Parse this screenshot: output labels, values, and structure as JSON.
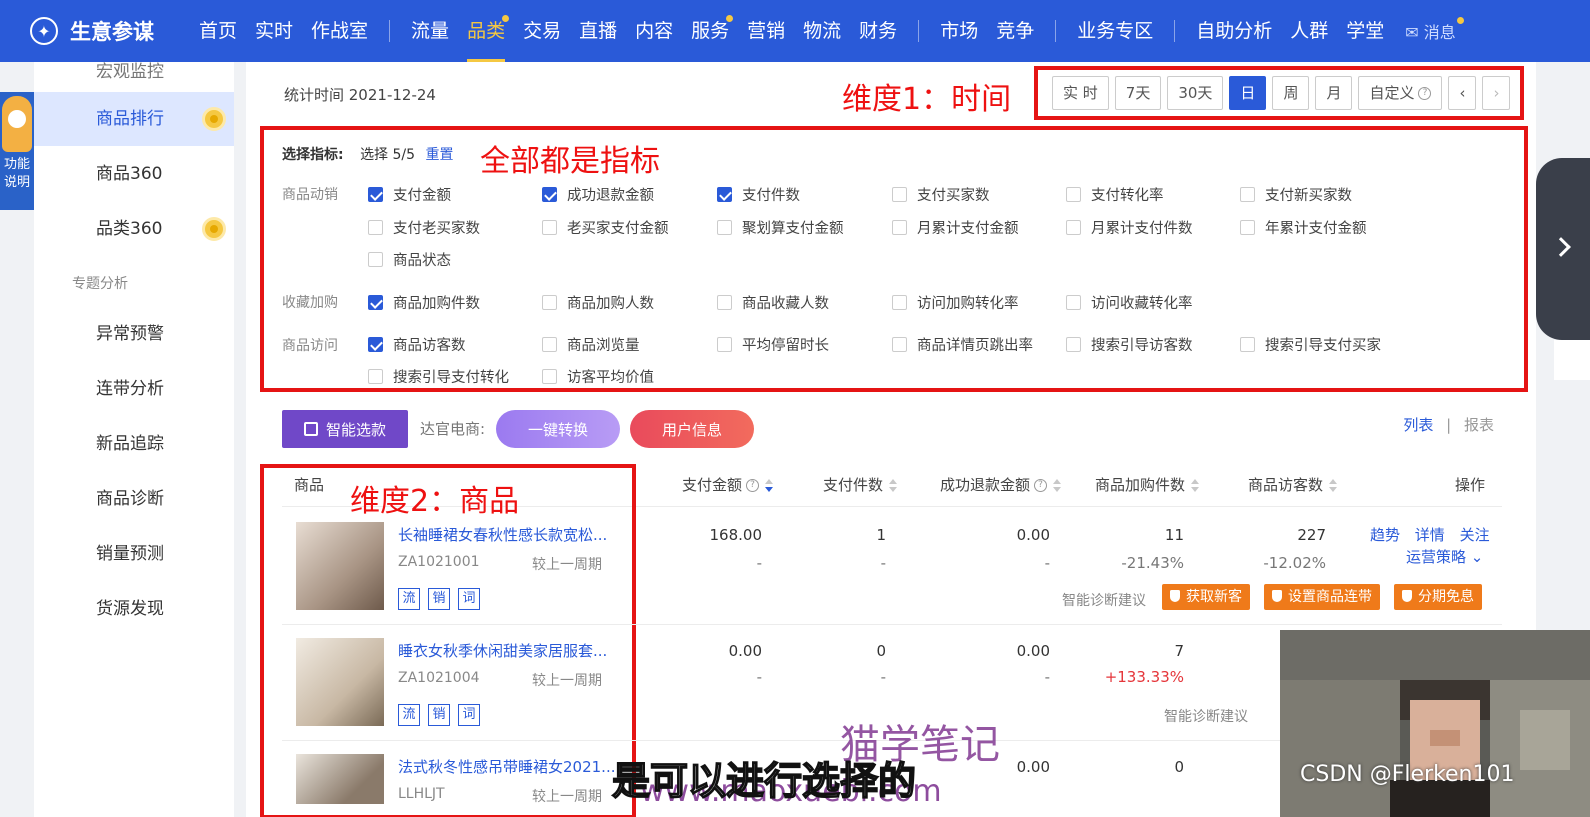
{
  "topnav": {
    "logo_text": "生意参谋",
    "items": [
      "首页",
      "实时",
      "作战室",
      "流量",
      "品类",
      "交易",
      "直播",
      "内容",
      "服务",
      "营销",
      "物流",
      "财务",
      "市场",
      "竞争",
      "业务专区",
      "自助分析",
      "人群",
      "学堂"
    ],
    "active": "品类",
    "message": "消息"
  },
  "helper": {
    "label": "功能说明"
  },
  "sidebar": {
    "top_partial": "宏观监控",
    "items_a": [
      "商品排行",
      "商品360",
      "品类360"
    ],
    "section": "专题分析",
    "items_b": [
      "异常预警",
      "连带分析",
      "新品追踪",
      "商品诊断",
      "销量预测",
      "货源发现"
    ]
  },
  "main": {
    "stat_time": "统计时间 2021-12-24",
    "time_buttons": [
      "实 时",
      "7天",
      "30天",
      "日",
      "周",
      "月",
      "自定义"
    ],
    "time_active": "日",
    "annotations": {
      "time": "维度1：时间",
      "metrics": "全部都是指标",
      "product": "维度2：商品"
    },
    "metrics": {
      "select_label": "选择指标:",
      "count": "选择 5/5",
      "reset": "重置",
      "groups": [
        {
          "label": "商品动销",
          "items": [
            "支付金额",
            "成功退款金额",
            "支付件数",
            "支付买家数",
            "支付转化率",
            "支付新买家数",
            "支付老买家数",
            "老买家支付金额",
            "聚划算支付金额",
            "月累计支付金额",
            "月累计支付件数",
            "年累计支付金额",
            "商品状态"
          ],
          "checked": [
            0,
            1,
            2
          ]
        },
        {
          "label": "收藏加购",
          "items": [
            "商品加购件数",
            "商品加购人数",
            "商品收藏人数",
            "访问加购转化率",
            "访问收藏转化率"
          ],
          "checked": [
            0
          ]
        },
        {
          "label": "商品访问",
          "items": [
            "商品访客数",
            "商品浏览量",
            "平均停留时长",
            "商品详情页跳出率",
            "搜索引导访客数",
            "搜索引导支付买家",
            "搜索引导支付转化",
            "访客平均价值"
          ],
          "checked": [
            0
          ]
        }
      ]
    },
    "toolbar": {
      "smart": "智能选款",
      "daguan": "达官电商:",
      "convert": "一键转换",
      "userinfo": "用户信息",
      "view_list": "列表",
      "view_sep": "|",
      "view_report": "报表"
    },
    "table": {
      "headers": [
        "商品",
        "支付金额",
        "支付件数",
        "成功退款金额",
        "商品加购件数",
        "商品访客数",
        "操作"
      ],
      "compare_label": "较上一周期",
      "tags": [
        "流",
        "销",
        "词"
      ],
      "ops": [
        "趋势",
        "详情",
        "关注"
      ],
      "strategy": "运营策略",
      "diag_label": "智能诊断建议",
      "diag_buttons": [
        "获取新客",
        "设置商品连带",
        "分期免息"
      ],
      "rows": [
        {
          "name": "长袖睡裙女春秋性感长款宽松...",
          "id": "ZA1021001",
          "pay": "168.00",
          "qty": "1",
          "refund": "0.00",
          "cart": "11",
          "visitors": "227",
          "pay_cmp": "-",
          "qty_cmp": "-",
          "refund_cmp": "-",
          "cart_cmp": "-21.43%",
          "visitors_cmp": "-12.02%"
        },
        {
          "name": "睡衣女秋季休闲甜美家居服套...",
          "id": "ZA1021004",
          "pay": "0.00",
          "qty": "0",
          "refund": "0.00",
          "cart": "7",
          "pay_cmp": "-",
          "qty_cmp": "-",
          "refund_cmp": "-",
          "cart_cmp": "+133.33%"
        },
        {
          "name": "法式秋冬性感吊带睡裙女2021...",
          "id": "LLHLJT",
          "pay": "0.00",
          "qty": "",
          "refund": "",
          "cart": "0"
        }
      ]
    }
  },
  "overlay": {
    "watermark": "猫学笔记",
    "watermark_url": "www.maoxuebi.com",
    "subtitle": "是可以进行选择的",
    "csdn": "CSDN @Flerken101"
  }
}
